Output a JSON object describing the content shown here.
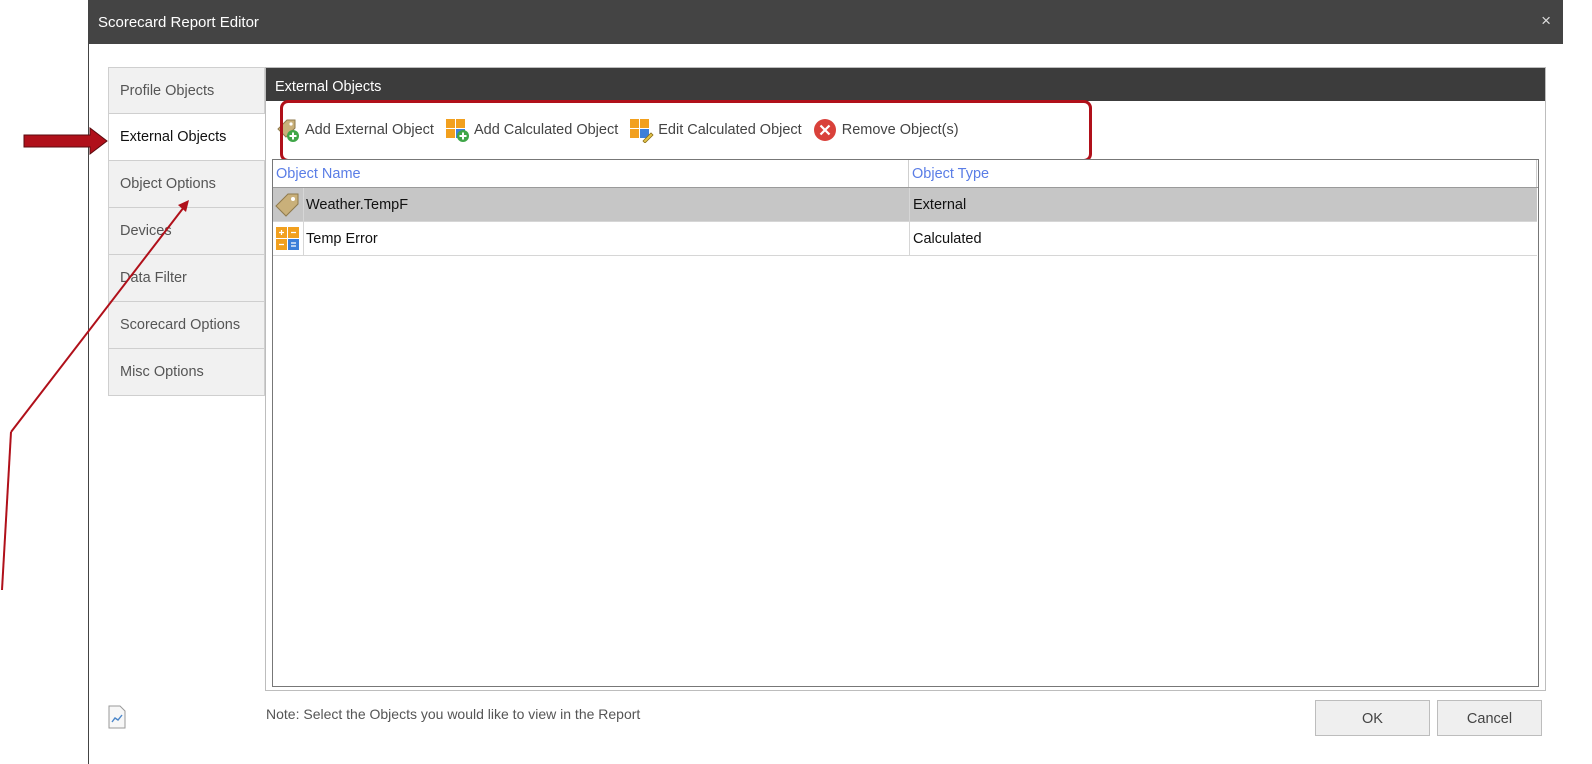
{
  "window": {
    "title": "Scorecard Report Editor",
    "close_glyph": "×"
  },
  "tabs": [
    {
      "label": "Profile Objects",
      "active": false
    },
    {
      "label": "External Objects",
      "active": true
    },
    {
      "label": "Object Options",
      "active": false
    },
    {
      "label": "Devices",
      "active": false
    },
    {
      "label": "Data Filter",
      "active": false
    },
    {
      "label": "Scorecard Options",
      "active": false
    },
    {
      "label": "Misc Options",
      "active": false
    }
  ],
  "panel": {
    "header": "External Objects",
    "toolbar": {
      "add_external": "Add External Object",
      "add_calculated": "Add Calculated Object",
      "edit_calculated": "Edit Calculated Object",
      "remove": "Remove Object(s)"
    },
    "columns": {
      "name": "Object Name",
      "type": "Object Type"
    },
    "rows": [
      {
        "name": "Weather.TempF",
        "type": "External",
        "icon": "tag-icon",
        "selected": true
      },
      {
        "name": "Temp Error",
        "type": "Calculated",
        "icon": "calculator-icon",
        "selected": false
      }
    ]
  },
  "footer": {
    "note": "Note: Select the Objects you would like to view in the Report",
    "ok": "OK",
    "cancel": "Cancel"
  },
  "colors": {
    "titlebar": "#444444",
    "panel_header": "#3c3c3c",
    "column_header_text": "#5a7de6",
    "selected_row": "#c6c6c6",
    "annotation": "#b0101a"
  }
}
